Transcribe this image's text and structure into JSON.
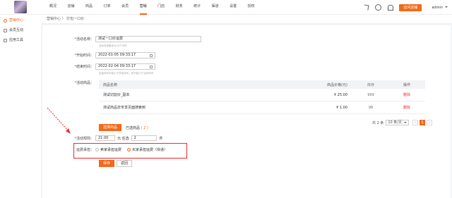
{
  "nav": [
    "概况",
    "店铺",
    "商品",
    "订单",
    "会员",
    "营销",
    "门店",
    "财务",
    "统计",
    "渠道",
    "设置",
    "授权"
  ],
  "nav_active_index": 5,
  "top": {
    "visit_label": "访问店铺",
    "user": "admin"
  },
  "sidebar": [
    {
      "label": "营销中心",
      "active": true
    },
    {
      "label": "会员互动",
      "active": false
    },
    {
      "label": "应用工具",
      "active": false
    }
  ],
  "breadcrumb": "营销中心 〉 打包一口价",
  "form": {
    "name_label": "活动名称：",
    "name_value": "测试一口价运费",
    "name_hint": "活动名称最多为20个字符",
    "start_label": "开始时间：",
    "start_value": "2022-01-05 09:33:17",
    "end_label": "结束时间：",
    "end_value": "2022-02-04 09:33:17",
    "time_hint": "结束时间不能小于开始时间，也不能小于当前时间",
    "goods_label": "活动商品："
  },
  "table": {
    "headers": [
      "商品名称",
      "商品价格(元)",
      "库存",
      "操作"
    ],
    "rows": [
      {
        "name": "测试切割价_副本",
        "price": "¥ 25.00",
        "stock": "999",
        "op": "删除"
      },
      {
        "name": "测试商品非专享页面搜索到",
        "price": "¥ 1.00",
        "stock": "98",
        "op": "删除"
      }
    ]
  },
  "pager": {
    "total": "共 2 条",
    "size": "10 条/页",
    "prev": "‹",
    "page": "1",
    "next": "›"
  },
  "tabs": {
    "select_label": "选择商品",
    "selected_label": "已选商品",
    "selected_count": "( 2 )"
  },
  "rule": {
    "label": "活动规则：",
    "price": "21.00",
    "mid_text": "元 任选",
    "qty": "2",
    "unit": "件"
  },
  "shipping": {
    "label": "运费承担：",
    "options": [
      "卖家承担运费",
      "买家承担运费（快递）"
    ],
    "selected_index": 1
  },
  "buttons": {
    "save": "保存",
    "back": "返回"
  },
  "colors": {
    "accent": "#f26a1b",
    "highlight": "#e33333"
  }
}
